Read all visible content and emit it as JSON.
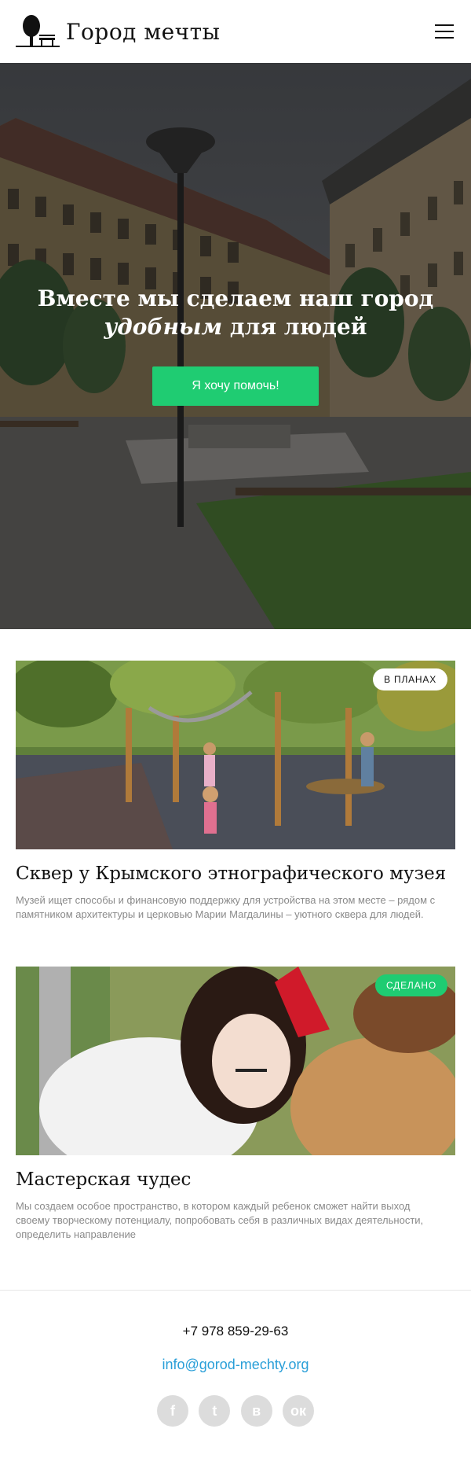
{
  "header": {
    "logo_text": "Город мечты",
    "menu_icon": "hamburger-icon"
  },
  "hero": {
    "title_line1": "Вместе мы сделаем наш город",
    "title_line2_em": "удобным",
    "title_line2_rest": " для людей",
    "cta_label": "Я хочу помочь!"
  },
  "projects": [
    {
      "badge": "В ПЛАНАХ",
      "title": "Сквер у Крымского этнографического музея",
      "text": "Музей ищет способы и финансовую поддержку для устройства на этом месте – рядом с памятником архитектуры и церковью Марии Магдалины – уютного сквера для людей."
    },
    {
      "badge": "СДЕЛАНО",
      "title": "Мастерская чудес",
      "text": "Мы создаем особое пространство, в котором каждый ребенок сможет найти выход своему творческому потенциалу, попробовать себя в различных видах деятельности, определить направление"
    }
  ],
  "footer": {
    "phone": "+7 978 859-29-63",
    "email": "info@gorod-mechty.org",
    "socials": [
      {
        "name": "facebook",
        "glyph": "f"
      },
      {
        "name": "twitter",
        "glyph": "t"
      },
      {
        "name": "vk",
        "glyph": "в"
      },
      {
        "name": "odnoklassniki",
        "glyph": "ок"
      }
    ]
  },
  "colors": {
    "accent_green": "#1fcc72",
    "link_blue": "#2a9fd8",
    "muted_text": "#8a8a8a"
  }
}
